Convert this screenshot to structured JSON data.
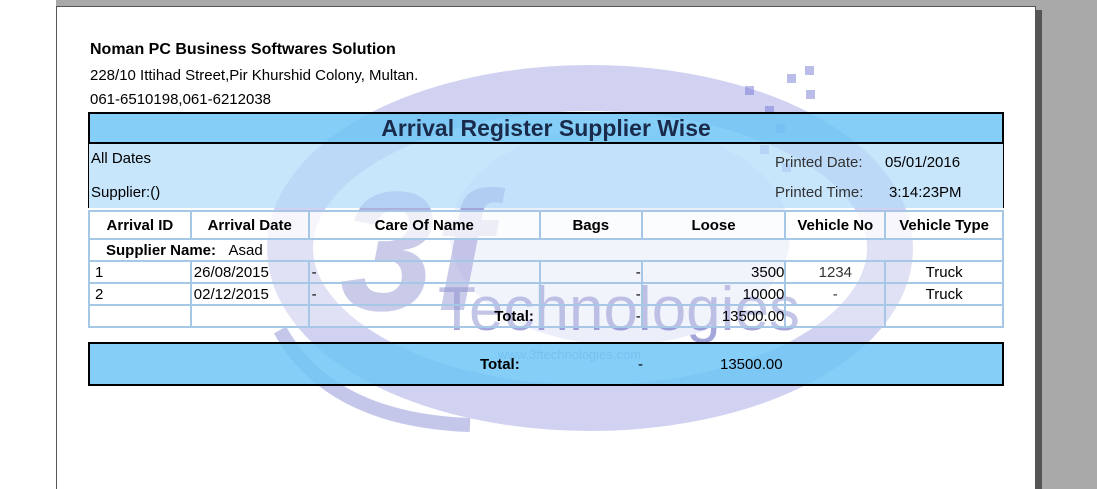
{
  "header": {
    "company": "Noman PC Business Softwares Solution",
    "address": "228/10 Ittihad Street,Pir Khurshid Colony, Multan.",
    "phone": "061-6510198,061-6212038"
  },
  "report": {
    "title": "Arrival Register Supplier Wise",
    "date_filter": "All Dates",
    "supplier_filter": "Supplier:()",
    "printed_date_label": "Printed Date:",
    "printed_date": "05/01/2016",
    "printed_time_label": "Printed Time:",
    "printed_time": "3:14:23PM"
  },
  "table": {
    "columns": [
      "Arrival ID",
      "Arrival Date",
      "Care Of Name",
      "Bags",
      "Loose",
      "Vehicle No",
      "Vehicle Type"
    ],
    "group_label": "Supplier Name:",
    "group_value": "Asad",
    "rows": [
      {
        "id": "1",
        "date": "26/08/2015",
        "care_of": "-",
        "bags": "-",
        "loose": "3500",
        "vehicle_no": "1234",
        "vehicle_type": "Truck"
      },
      {
        "id": "2",
        "date": "02/12/2015",
        "care_of": "-",
        "bags": "-",
        "loose": "10000",
        "vehicle_no": "-",
        "vehicle_type": "Truck"
      }
    ],
    "subtotal": {
      "label": "Total:",
      "bags": "-",
      "loose": "13500.00"
    },
    "grand_total": {
      "label": "Total:",
      "bags": "-",
      "loose": "13500.00"
    }
  },
  "watermark": {
    "logo": "3f",
    "name": "Technologies",
    "url": "www.3ftechnologies.com",
    "color": "#4b4fb5"
  }
}
